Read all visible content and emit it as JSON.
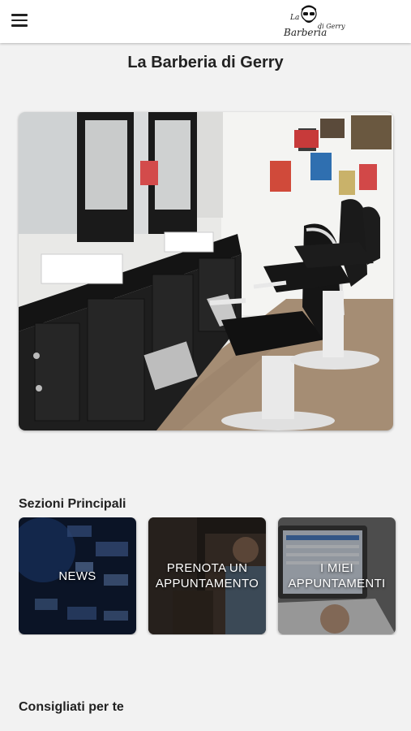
{
  "header": {
    "menu_icon": "hamburger-menu-icon",
    "logo": {
      "line1": "La",
      "line2": "Barberia",
      "line3": "di Gerry"
    }
  },
  "page": {
    "title": "La Barberia di Gerry"
  },
  "sections": {
    "main_title": "Sezioni Principali",
    "cards": [
      {
        "label": "NEWS"
      },
      {
        "label": "PRENOTA UN APPUNTAMENTO"
      },
      {
        "label": "I MIEI APPUNTAMENTI"
      }
    ],
    "recommended_title": "Consigliati per te"
  },
  "colors": {
    "background": "#f2f2f2",
    "topbar": "#ffffff",
    "text": "#222222"
  }
}
